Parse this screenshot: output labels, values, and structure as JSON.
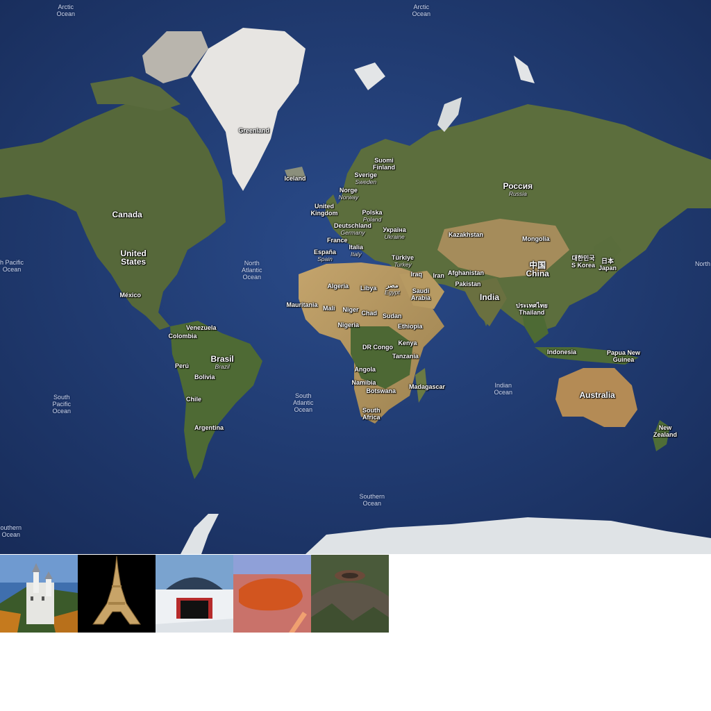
{
  "map": {
    "colors": {
      "ocean": "#23407a",
      "deep_ocean": "#1a2f5f",
      "land": "#5e6f3c",
      "desert": "#b79a62",
      "ice": "#e9ecef"
    },
    "labels": [
      {
        "id": "arctic-ocean-west",
        "primary": "Arctic\nOcean",
        "kind": "ocean"
      },
      {
        "id": "arctic-ocean-east",
        "primary": "Arctic\nOcean",
        "kind": "ocean"
      },
      {
        "id": "greenland",
        "primary": "Greenland"
      },
      {
        "id": "iceland",
        "primary": "Iceland"
      },
      {
        "id": "canada",
        "primary": "Canada",
        "kind": "big"
      },
      {
        "id": "united-states",
        "primary": "United\nStates",
        "kind": "big"
      },
      {
        "id": "mexico",
        "primary": "México"
      },
      {
        "id": "north-pacific-west",
        "primary": "h Pacific\nOcean",
        "kind": "ocean"
      },
      {
        "id": "north-pacific-east",
        "primary": "North",
        "kind": "ocean"
      },
      {
        "id": "north-atlantic",
        "primary": "North\nAtlantic\nOcean",
        "kind": "ocean"
      },
      {
        "id": "venezuela",
        "primary": "Venezuela"
      },
      {
        "id": "colombia",
        "primary": "Colombia"
      },
      {
        "id": "peru",
        "primary": "Perú"
      },
      {
        "id": "brasil",
        "primary": "Brasil",
        "secondary": "Brazil",
        "kind": "big"
      },
      {
        "id": "bolivia",
        "primary": "Bolivia"
      },
      {
        "id": "chile",
        "primary": "Chile"
      },
      {
        "id": "argentina",
        "primary": "Argentina"
      },
      {
        "id": "south-pacific",
        "primary": "South\nPacific\nOcean",
        "kind": "ocean"
      },
      {
        "id": "south-atlantic",
        "primary": "South\nAtlantic\nOcean",
        "kind": "ocean"
      },
      {
        "id": "southern-ocean-center",
        "primary": "Southern\nOcean",
        "kind": "ocean"
      },
      {
        "id": "southern-ocean-west",
        "primary": "outhern\nOcean",
        "kind": "ocean"
      },
      {
        "id": "suomi",
        "primary": "Suomi\nFinland"
      },
      {
        "id": "sverige",
        "primary": "Sverige",
        "secondary": "Sweden"
      },
      {
        "id": "norge",
        "primary": "Norge",
        "secondary": "Norway"
      },
      {
        "id": "united-kingdom",
        "primary": "United\nKingdom"
      },
      {
        "id": "polska",
        "primary": "Polska",
        "secondary": "Poland"
      },
      {
        "id": "deutschland",
        "primary": "Deutschland",
        "secondary": "Germany"
      },
      {
        "id": "ukraina",
        "primary": "Україна",
        "secondary": "Ukraine"
      },
      {
        "id": "france",
        "primary": "France"
      },
      {
        "id": "espana",
        "primary": "España",
        "secondary": "Spain"
      },
      {
        "id": "italia",
        "primary": "Italia",
        "secondary": "Italy"
      },
      {
        "id": "turkiye",
        "primary": "Türkiye",
        "secondary": "Turkey"
      },
      {
        "id": "rossiya",
        "primary": "Россия",
        "secondary": "Russia",
        "kind": "big"
      },
      {
        "id": "kazakhstan",
        "primary": "Kazakhstan"
      },
      {
        "id": "mongolia",
        "primary": "Mongolia"
      },
      {
        "id": "china",
        "primary": "中国\nChina",
        "kind": "big"
      },
      {
        "id": "korea",
        "primary": "대한민국\nS Korea"
      },
      {
        "id": "japan",
        "primary": "日本\nJapan"
      },
      {
        "id": "iraq",
        "primary": "Iraq"
      },
      {
        "id": "iran",
        "primary": "Iran"
      },
      {
        "id": "afghanistan",
        "primary": "Afghanistan"
      },
      {
        "id": "pakistan",
        "primary": "Pakistan"
      },
      {
        "id": "india",
        "primary": "India",
        "kind": "big"
      },
      {
        "id": "thailand",
        "primary": "ประเทศไทย\nThailand"
      },
      {
        "id": "saudi-arabia",
        "primary": "Saudi\nArabia"
      },
      {
        "id": "algeria",
        "primary": "Algeria"
      },
      {
        "id": "libya",
        "primary": "Libya"
      },
      {
        "id": "egypt",
        "primary": "مصر",
        "secondary": "Egypt"
      },
      {
        "id": "mauritania",
        "primary": "Mauritania"
      },
      {
        "id": "mali",
        "primary": "Mali"
      },
      {
        "id": "niger",
        "primary": "Niger"
      },
      {
        "id": "chad",
        "primary": "Chad"
      },
      {
        "id": "sudan",
        "primary": "Sudan"
      },
      {
        "id": "nigeria",
        "primary": "Nigeria"
      },
      {
        "id": "ethiopia",
        "primary": "Ethiopia"
      },
      {
        "id": "dr-congo",
        "primary": "DR Congo"
      },
      {
        "id": "kenya",
        "primary": "Kenya"
      },
      {
        "id": "tanzania",
        "primary": "Tanzania"
      },
      {
        "id": "angola",
        "primary": "Angola"
      },
      {
        "id": "namibia",
        "primary": "Namibia"
      },
      {
        "id": "botswana",
        "primary": "Botswana"
      },
      {
        "id": "madagascar",
        "primary": "Madagascar"
      },
      {
        "id": "south-africa",
        "primary": "South\nAfrica"
      },
      {
        "id": "indian-ocean",
        "primary": "Indian\nOcean",
        "kind": "ocean"
      },
      {
        "id": "indonesia",
        "primary": "Indonesia"
      },
      {
        "id": "papua-new-guinea",
        "primary": "Papua New\nGuinea"
      },
      {
        "id": "australia",
        "primary": "Australia",
        "kind": "big"
      },
      {
        "id": "new-zealand",
        "primary": "New\nZealand"
      }
    ]
  },
  "thumbnails": [
    {
      "id": "castle-thumbnail",
      "icon": "castle-icon"
    },
    {
      "id": "tower-thumbnail",
      "icon": "tower-icon"
    },
    {
      "id": "dome-thumbnail",
      "icon": "dome-icon"
    },
    {
      "id": "rock-thumbnail",
      "icon": "rock-icon"
    },
    {
      "id": "volcano-thumbnail",
      "icon": "volcano-icon"
    }
  ]
}
